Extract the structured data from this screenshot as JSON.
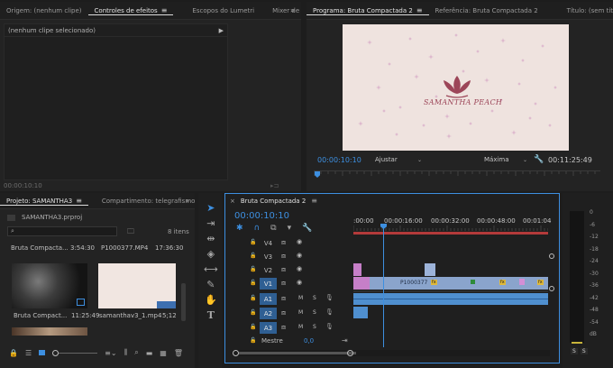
{
  "source_panel": {
    "tabs": [
      {
        "label": "Origem: (nenhum clipe)"
      },
      {
        "label": "Controles de efeitos"
      },
      {
        "label": "Escopos do Lumetri"
      },
      {
        "label": "Mixer de clip"
      }
    ],
    "message": "(nenhum clipe selecionado)",
    "timecode": "00:00:10:10"
  },
  "program_panel": {
    "tabs": [
      {
        "label": "Programa: Bruta Compactada 2"
      },
      {
        "label": "Referência: Bruta Compactada 2"
      },
      {
        "label": "Título: (sem título)"
      }
    ],
    "logo_text": "SAMANTHA PEACH",
    "timecode": "00:00:10:10",
    "fit_label": "Ajustar",
    "quality_label": "Máxima",
    "duration": "00:11:25:49"
  },
  "project_panel": {
    "tab_label": "Projeto: SAMANTHA3",
    "tab2_label": "Compartimento: telegrafismos",
    "file_name": "SAMANTHA3.prproj",
    "item_count": "8 itens",
    "items": [
      {
        "name": "Bruta Compacta...",
        "duration": "3:54:30"
      },
      {
        "name": "P1000377.MP4",
        "duration": "17:36:30"
      },
      {
        "name": "Bruta Compact...",
        "duration": "11:25:49"
      },
      {
        "name": "samanthav3_1.mp4",
        "duration": "5;12"
      }
    ]
  },
  "timeline_panel": {
    "tab_label": "Bruta Compactada 2",
    "timecode": "00:00:10:10",
    "ruler_labels": [
      ":00:00",
      "00:00:16:00",
      "00:00:32:00",
      "00:00:48:00",
      "00:01:04"
    ],
    "video_tracks": [
      "V4",
      "V3",
      "V2",
      "V1"
    ],
    "audio_tracks": [
      "A1",
      "A2",
      "A3"
    ],
    "master_label": "Mestre",
    "master_value": "0,0",
    "clip_label": "P1000377",
    "m_label": "M",
    "s_label": "S",
    "fx_label": "fx"
  },
  "meter": {
    "labels": [
      "0",
      "-6",
      "-12",
      "-18",
      "-24",
      "-30",
      "-36",
      "-42",
      "-48",
      "-54",
      "dB"
    ],
    "solo_labels": [
      "S",
      "S"
    ]
  },
  "colors": {
    "accent": "#3d8fe0",
    "clip_video": "#8aa4cc",
    "clip_audio": "#4f8fcf",
    "clip_pink": "#c67fc8",
    "playhead": "#3d8fe0"
  }
}
